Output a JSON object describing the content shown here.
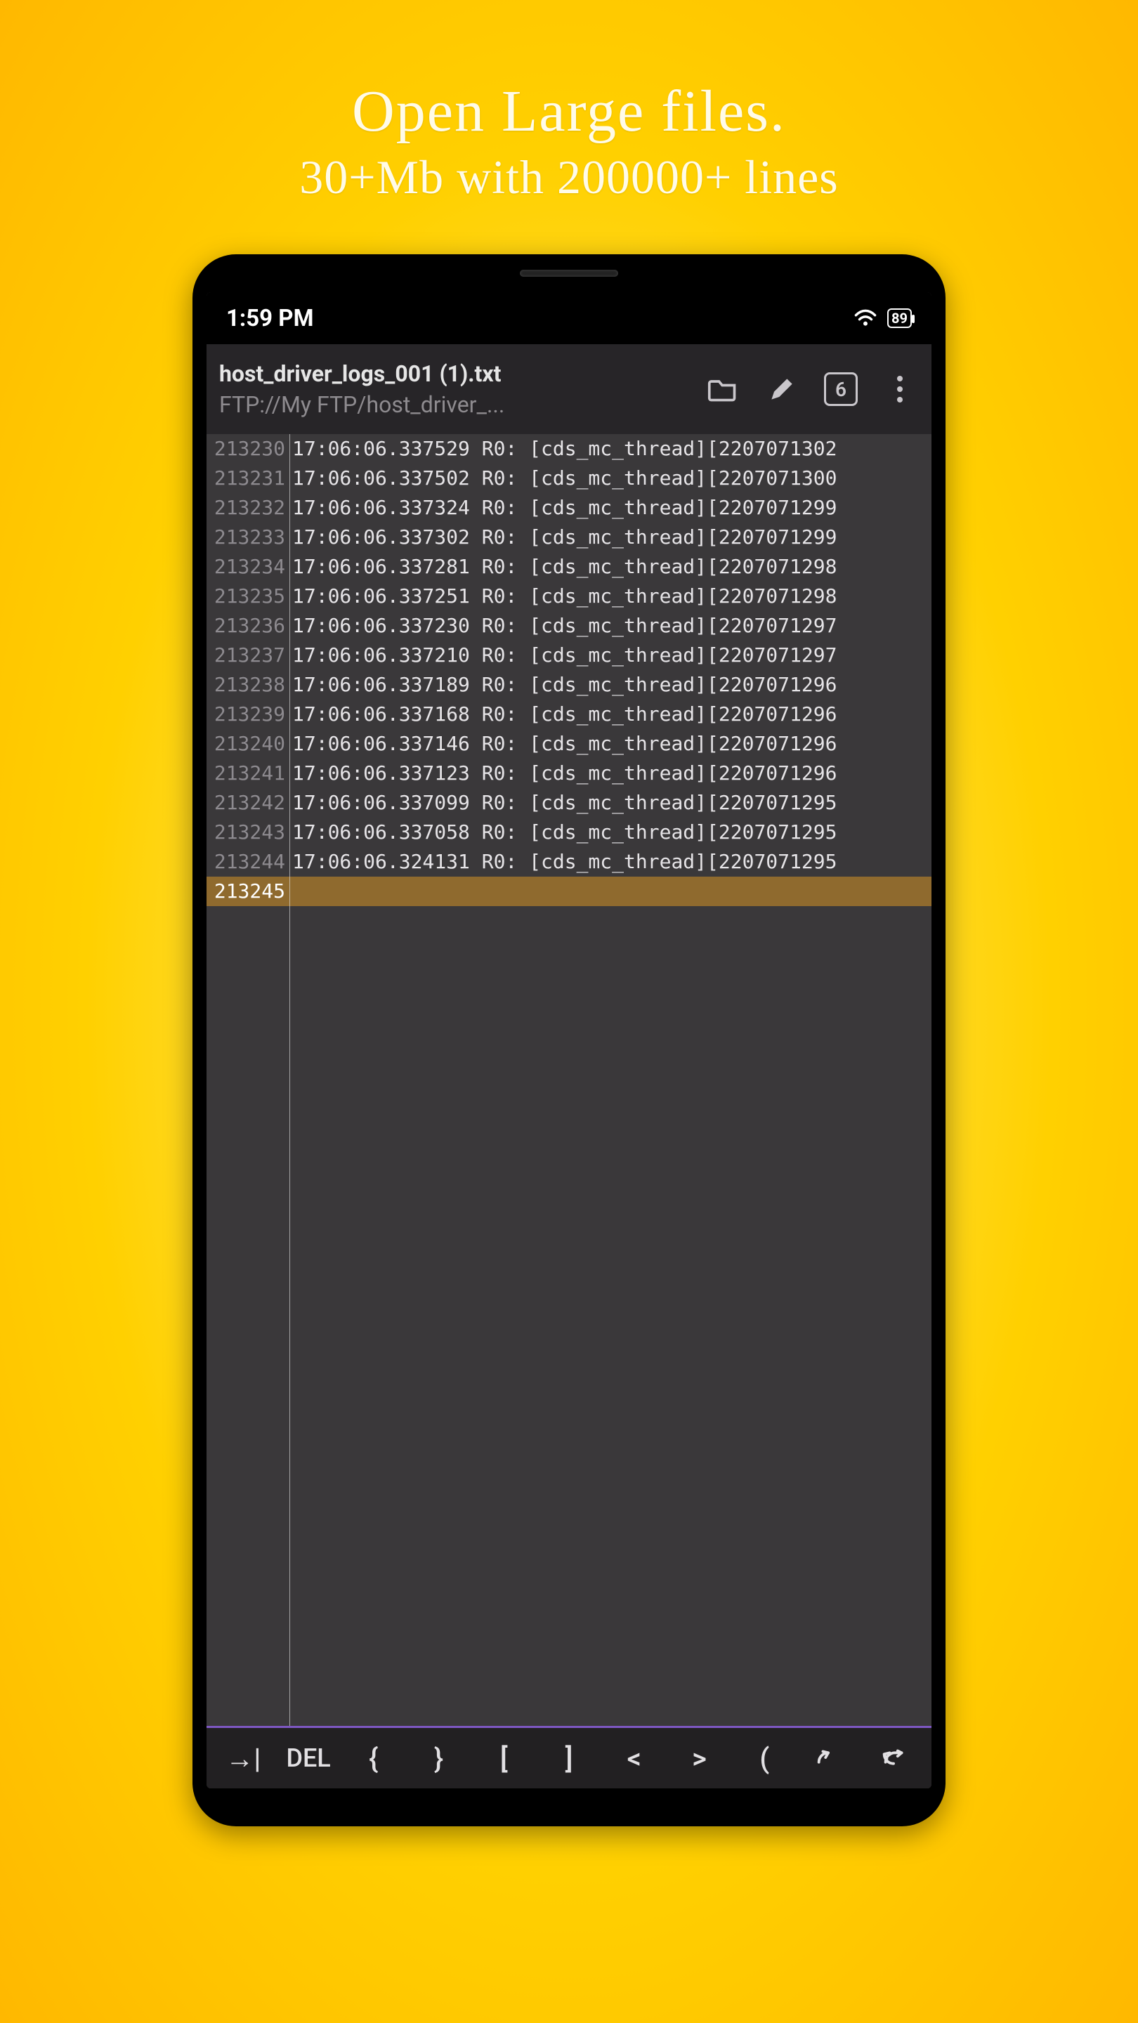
{
  "promo": {
    "line1": "Open Large files.",
    "line2": "30+Mb with 200000+ lines"
  },
  "statusbar": {
    "time": "1:59 PM",
    "battery": "89"
  },
  "appbar": {
    "title": "host_driver_logs_001 (1).txt",
    "subtitle": "FTP://My FTP/host_driver_...",
    "tab_count": "6"
  },
  "editor": {
    "lines": [
      {
        "num": "213230",
        "text": "17:06:06.337529   R0: [cds_mc_thread][2207071302"
      },
      {
        "num": "213231",
        "text": "17:06:06.337502   R0: [cds_mc_thread][2207071300"
      },
      {
        "num": "213232",
        "text": "17:06:06.337324   R0: [cds_mc_thread][2207071299"
      },
      {
        "num": "213233",
        "text": "17:06:06.337302   R0: [cds_mc_thread][2207071299"
      },
      {
        "num": "213234",
        "text": "17:06:06.337281   R0: [cds_mc_thread][2207071298"
      },
      {
        "num": "213235",
        "text": "17:06:06.337251   R0: [cds_mc_thread][2207071298"
      },
      {
        "num": "213236",
        "text": "17:06:06.337230   R0: [cds_mc_thread][2207071297"
      },
      {
        "num": "213237",
        "text": "17:06:06.337210   R0: [cds_mc_thread][2207071297"
      },
      {
        "num": "213238",
        "text": "17:06:06.337189   R0: [cds_mc_thread][2207071296"
      },
      {
        "num": "213239",
        "text": "17:06:06.337168   R0: [cds_mc_thread][2207071296"
      },
      {
        "num": "213240",
        "text": "17:06:06.337146   R0: [cds_mc_thread][2207071296"
      },
      {
        "num": "213241",
        "text": "17:06:06.337123   R0: [cds_mc_thread][2207071296"
      },
      {
        "num": "213242",
        "text": "17:06:06.337099   R0: [cds_mc_thread][2207071295"
      },
      {
        "num": "213243",
        "text": "17:06:06.337058   R0: [cds_mc_thread][2207071295"
      },
      {
        "num": "213244",
        "text": "17:06:06.324131   R0: [cds_mc_thread][2207071295"
      }
    ],
    "cursor_line": "213245"
  },
  "keys": {
    "tab": "→|",
    "del": "DEL",
    "lbrace": "{",
    "rbrace": "}",
    "lbracket": "[",
    "rbracket": "]",
    "lt": "<",
    "gt": ">",
    "lparen": "("
  }
}
